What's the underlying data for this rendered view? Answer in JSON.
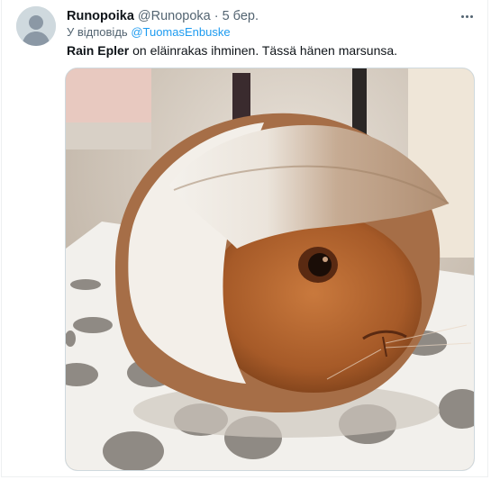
{
  "tweet": {
    "display_name": "Runopoika",
    "handle": "@Runopoka",
    "separator": "·",
    "timestamp": "5 бер.",
    "reply_prefix": "У відповідь",
    "reply_to": "@TuomasEnbuske",
    "text_mention": "Rain Epler",
    "text_rest": " on eläinrakas ihminen. Tässä hänen marsunsa."
  },
  "icons": {
    "avatar": "default-avatar-icon",
    "more": "more-horizontal-icon"
  },
  "colors": {
    "link": "#1d9bf0",
    "muted": "#536471",
    "text": "#0f1419"
  }
}
